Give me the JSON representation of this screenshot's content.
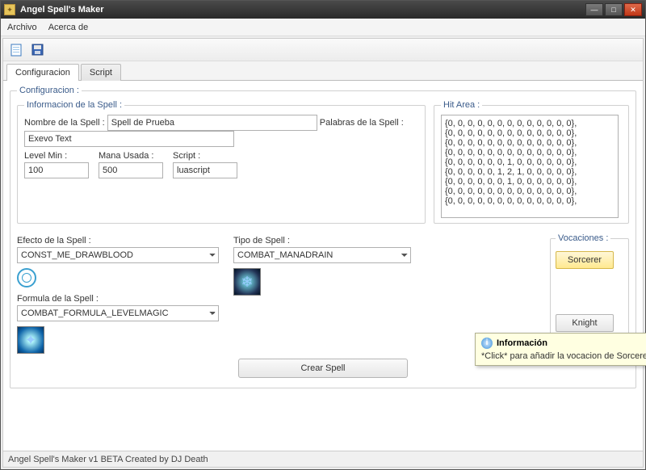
{
  "window": {
    "title": "Angel Spell's Maker"
  },
  "menu": {
    "file": "Archivo",
    "about": "Acerca de"
  },
  "tabs": {
    "config": "Configuracion",
    "script": "Script"
  },
  "group": {
    "config": "Configuracion :",
    "info": "Informacion de la Spell :",
    "hit": "Hit Area :",
    "voc": "Vocaciones :"
  },
  "labels": {
    "name": "Nombre de la Spell :",
    "words": "Palabras de la Spell :",
    "level": "Level Min :",
    "mana": "Mana Usada :",
    "script": "Script :",
    "effect": "Efecto de la Spell :",
    "type": "Tipo de Spell :",
    "formula": "Formula de la Spell :"
  },
  "values": {
    "name": "Spell de Prueba",
    "words": "Exevo Text",
    "level": "100",
    "mana": "500",
    "script": "luascript",
    "effect": "CONST_ME_DRAWBLOOD",
    "type": "COMBAT_MANADRAIN",
    "formula": "COMBAT_FORMULA_LEVELMAGIC"
  },
  "hitarea": [
    "{0, 0, 0, 0, 0, 0, 0, 0, 0, 0, 0, 0, 0},",
    "{0, 0, 0, 0, 0, 0, 0, 0, 0, 0, 0, 0, 0},",
    "{0, 0, 0, 0, 0, 0, 0, 0, 0, 0, 0, 0, 0},",
    "{0, 0, 0, 0, 0, 0, 0, 0, 0, 0, 0, 0, 0},",
    "{0, 0, 0, 0, 0, 0, 1, 0, 0, 0, 0, 0, 0},",
    "{0, 0, 0, 0, 0, 1, 2, 1, 0, 0, 0, 0, 0},",
    "{0, 0, 0, 0, 0, 0, 1, 0, 0, 0, 0, 0, 0},",
    "{0, 0, 0, 0, 0, 0, 0, 0, 0, 0, 0, 0, 0},",
    "{0, 0, 0, 0, 0, 0, 0, 0, 0, 0, 0, 0, 0},"
  ],
  "vocations": {
    "sorcerer": "Sorcerer",
    "knight": "Knight"
  },
  "buttons": {
    "create": "Crear Spell"
  },
  "tooltip": {
    "title": "Información",
    "body": "*Click* para añadir la vocacion de Sorcerer"
  },
  "status": "Angel Spell's Maker v1 BETA Created by DJ Death"
}
